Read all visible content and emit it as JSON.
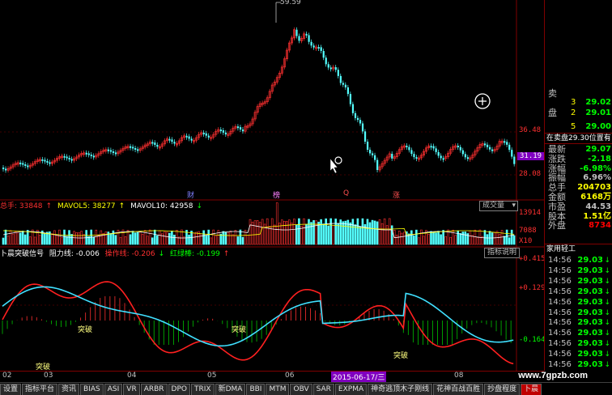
{
  "price_axis": {
    "ticks": [
      "36.48",
      "28.08"
    ],
    "current": "31.19",
    "peak_label": "59.59"
  },
  "event_markers": [
    "财",
    "榜",
    "Q",
    "涨"
  ],
  "volume": {
    "header": {
      "total_label": "总手: 33848",
      "mavol5": "MAVOL5: 38277",
      "mavol10": "MAVOL10: 42958"
    },
    "select": "成交量",
    "ticks": [
      "13914",
      "7088",
      "X10"
    ]
  },
  "indicator": {
    "header": {
      "name": "卜晨突破信号",
      "r": "阻力线: -0.006",
      "c": "操作线: -0.206",
      "g": "红绿棒: -0.199"
    },
    "button": "指标说明",
    "ticks": [
      "+0.415",
      "+0.129",
      "-0.164"
    ],
    "signal_label": "突破"
  },
  "date_axis": {
    "months": [
      "02",
      "03",
      "04",
      "05",
      "06",
      "08"
    ],
    "cursor_date": "2015-06-17/三"
  },
  "quote_panel": {
    "top": [
      {
        "l": "卖",
        "m": "",
        "r": ""
      },
      {
        "l": "",
        "m": "3",
        "r": "29.02"
      },
      {
        "l": "盘",
        "m": "2",
        "r": "29.01"
      },
      {
        "l": "",
        "m": "5",
        "r": "29.00"
      }
    ],
    "status": "在卖盘29.30位置有",
    "fields": [
      {
        "l": "最新",
        "r": "29.07",
        "c": "#00ff00"
      },
      {
        "l": "涨跌",
        "r": "-2.18",
        "c": "#00ff00"
      },
      {
        "l": "涨幅",
        "r": "-6.98%",
        "c": "#00ff00"
      },
      {
        "l": "振幅",
        "r": "6.96%",
        "c": "#c0c0c0"
      },
      {
        "l": "总手",
        "r": "204703",
        "c": "#ffff00"
      },
      {
        "l": "金额",
        "r": "6168万",
        "c": "#ffff00"
      },
      {
        "l": "市盈",
        "r": "44.53",
        "c": "#c0c0c0"
      },
      {
        "l": "股本",
        "r": "1.51亿",
        "c": "#ffff00"
      },
      {
        "l": "外盘",
        "r": "8734",
        "c": "#ff0000"
      }
    ],
    "section_title": "家用轻工",
    "ticks": [
      {
        "t": "14:56",
        "p": "29.03"
      },
      {
        "t": "14:56",
        "p": "29.03"
      },
      {
        "t": "14:56",
        "p": "29.03"
      },
      {
        "t": "14:56",
        "p": "29.03"
      },
      {
        "t": "14:56",
        "p": "29.03"
      },
      {
        "t": "14:56",
        "p": "29.03"
      },
      {
        "t": "14:56",
        "p": "29.03"
      },
      {
        "t": "14:56",
        "p": "29.03"
      },
      {
        "t": "14:56",
        "p": "29.03"
      },
      {
        "t": "14:56",
        "p": "29.03"
      },
      {
        "t": "14:56",
        "p": "29.03"
      }
    ]
  },
  "tabs": [
    "设置",
    "指标平台",
    "资讯",
    "BIAS",
    "ASI",
    "VR",
    "ARBR",
    "DPO",
    "TRIX",
    "新DMA",
    "BBI",
    "MTM",
    "OBV",
    "SAR",
    "EXPMA",
    "神奇逃顶木子刚线",
    "花神百战百胜",
    "抄盘程度",
    "卜晨"
  ],
  "watermark": "www.7gpzb.com",
  "colors": {
    "up": "#ff3030",
    "down": "#54ffff",
    "frame": "#800000",
    "axis_text": "#ff3030"
  }
}
